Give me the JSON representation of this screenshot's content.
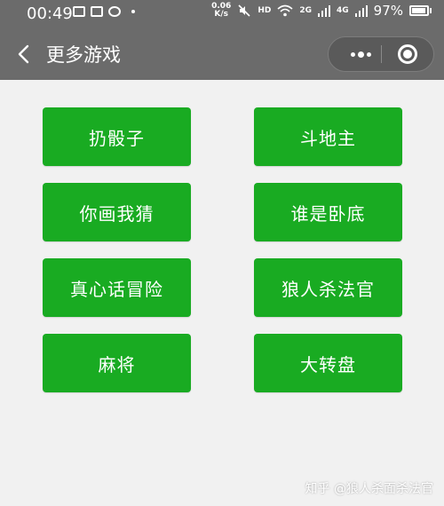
{
  "status_bar": {
    "time": "00:49",
    "speed_value": "0.06",
    "speed_unit": "K/s",
    "hd": "HD",
    "net_2g": "2G",
    "net_4g": "4G",
    "battery": "97%"
  },
  "nav": {
    "title": "更多游戏"
  },
  "games": [
    {
      "label": "扔骰子"
    },
    {
      "label": "斗地主"
    },
    {
      "label": "你画我猜"
    },
    {
      "label": "谁是卧底"
    },
    {
      "label": "真心话冒险"
    },
    {
      "label": "狼人杀法官"
    },
    {
      "label": "麻将"
    },
    {
      "label": "大转盘"
    }
  ],
  "watermark": "知乎 @狼人杀面杀法官",
  "colors": {
    "header_bg": "#6b6b6b",
    "page_bg": "#f1f1f1",
    "button_green": "#19ab22",
    "text_white": "#ffffff"
  }
}
